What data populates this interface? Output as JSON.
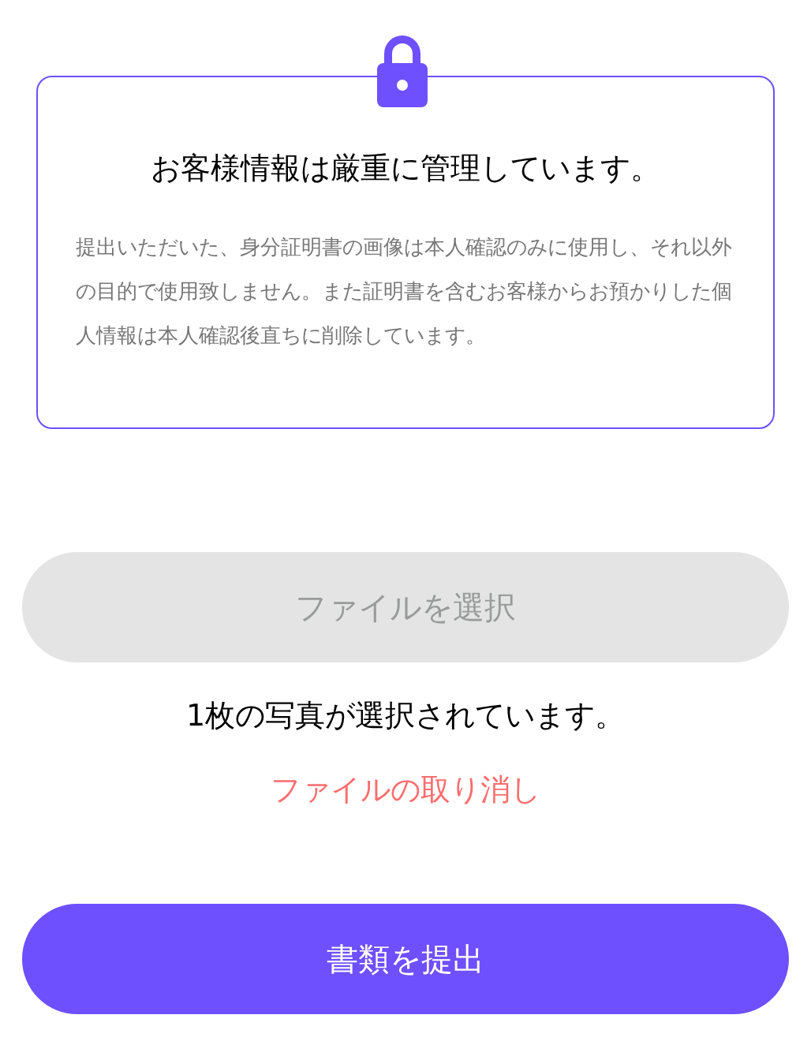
{
  "notice": {
    "title": "お客様情報は厳重に管理しています。",
    "body": "提出いただいた、身分証明書の画像は本人確認のみに使用し、それ以外の目的で使用致しません。また証明書を含むお客様からお預かりした個人情報は本人確認後直ちに削除しています。"
  },
  "file_button": {
    "label": "ファイルを選択",
    "disabled": true
  },
  "status": "1枚の写真が選択されています。",
  "cancel_link": "ファイルの取り消し",
  "submit_button": {
    "label": "書類を提出",
    "disabled": false
  }
}
